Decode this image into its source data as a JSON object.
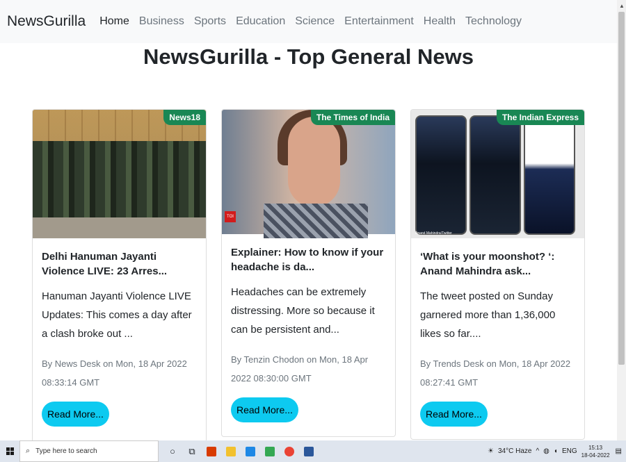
{
  "navbar": {
    "brand": "NewsGurilla",
    "links": [
      "Home",
      "Business",
      "Sports",
      "Education",
      "Science",
      "Entertainment",
      "Health",
      "Technology"
    ]
  },
  "heading": "NewsGurilla - Top General News",
  "cards": [
    {
      "source": "News18",
      "title": "Delhi Hanuman Jayanti Violence LIVE: 23 Arres...",
      "description": "Hanuman Jayanti Violence LIVE Updates: This comes a day after a clash broke out ...",
      "meta": "By News Desk on Mon, 18 Apr 2022 08:33:14 GMT",
      "button": "Read More..."
    },
    {
      "source": "The Times of India",
      "title": "Explainer: How to know if your headache is da...",
      "description": "Headaches can be extremely distressing. More so because it can be persistent and...",
      "meta": "By Tenzin Chodon on Mon, 18 Apr 2022 08:30:00 GMT",
      "button": "Read More...",
      "logo_text": "TOI"
    },
    {
      "source": "The Indian Express",
      "title": "‘What is your moonshot? ‘: Anand Mahindra ask...",
      "description": "The tweet posted on Sunday garnered more than 1,36,000 likes so far....",
      "meta": "By Trends Desk on Mon, 18 Apr 2022 08:27:41 GMT",
      "button": "Read More...",
      "image_credit": "Anand Mahindra/Twitter"
    }
  ],
  "taskbar": {
    "search_placeholder": "Type here to search",
    "weather": "34°C Haze",
    "language": "ENG",
    "time": "15:13",
    "date": "18-04-2022"
  },
  "colors": {
    "badge": "#198754",
    "button": "#0dcaf0",
    "navbar_bg": "#f8f9fa"
  }
}
